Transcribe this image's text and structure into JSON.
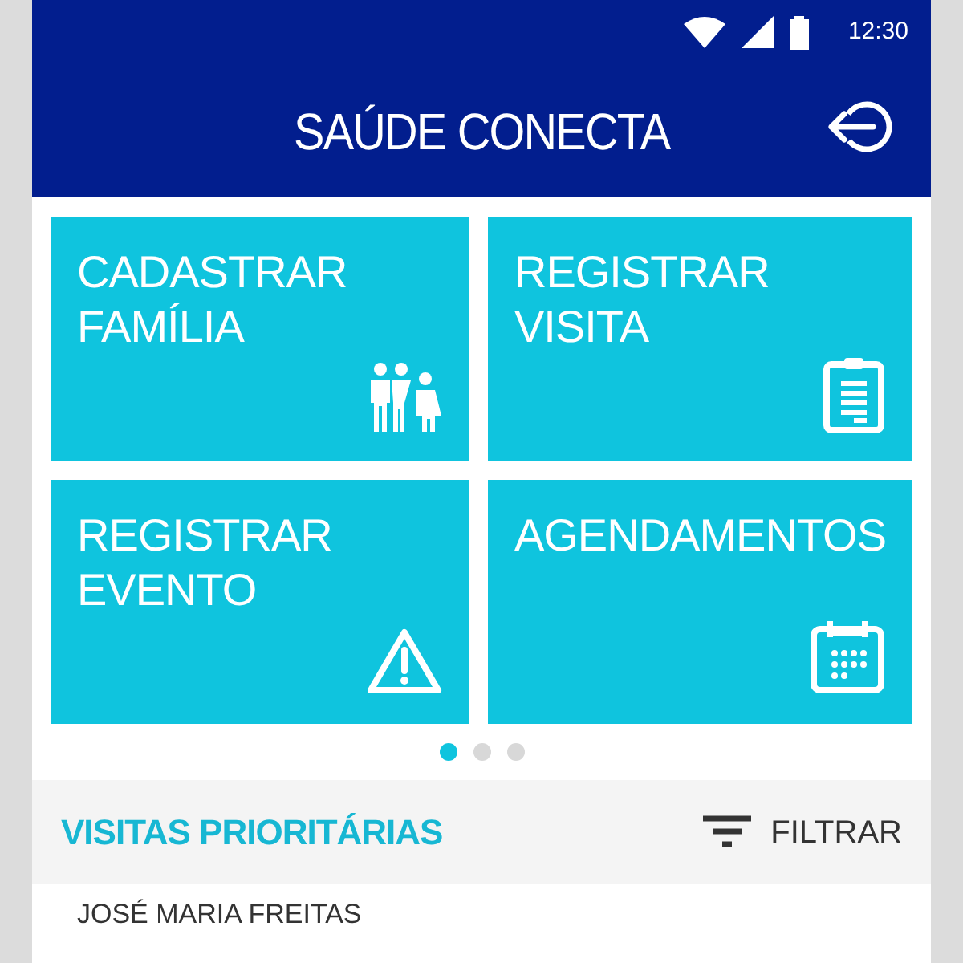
{
  "status_bar": {
    "time": "12:30"
  },
  "app_bar": {
    "title": "SAÚDE CONECTA"
  },
  "tiles": [
    {
      "label_lines": [
        "CADASTRAR",
        "FAMÍLIA"
      ],
      "kind": "family"
    },
    {
      "label_lines": [
        "REGISTRAR",
        "VISITA"
      ],
      "kind": "clipboard"
    },
    {
      "label_lines": [
        "REGISTRAR",
        "EVENTO"
      ],
      "kind": "warning"
    },
    {
      "label_lines": [
        "AGENDAMENTOS"
      ],
      "kind": "calendar"
    }
  ],
  "pager": [
    {
      "selected": true
    },
    {
      "selected": false
    },
    {
      "selected": false
    }
  ],
  "section": {
    "title": "VISITAS PRIORITÁRIAS",
    "filter_label": "FILTRAR"
  },
  "visits": [
    {
      "name": "JOSÉ MARIA FREITAS"
    }
  ]
}
